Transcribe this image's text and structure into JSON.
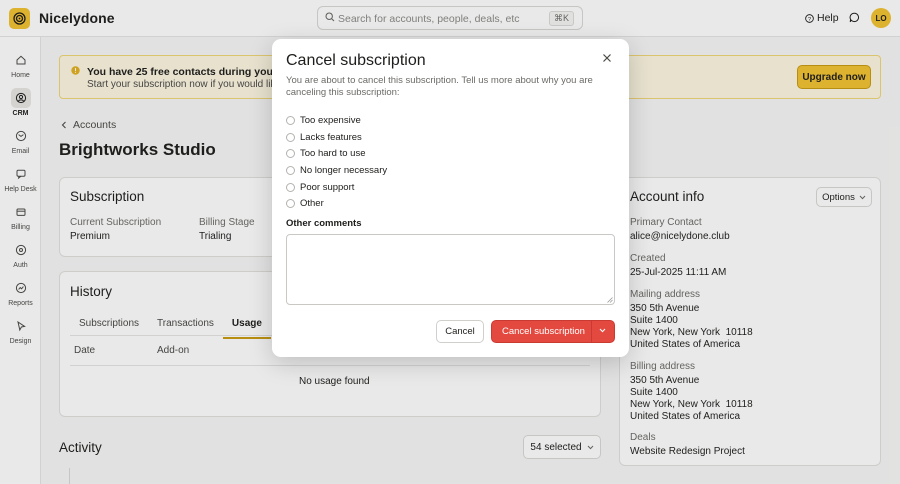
{
  "app": {
    "name": "Nicelydone"
  },
  "search": {
    "placeholder": "Search for accounts, people, deals, etc",
    "shortcut": "⌘K"
  },
  "header": {
    "help_label": "Help",
    "avatar_initials": "LO"
  },
  "sidebar": {
    "items": [
      {
        "label": "Home",
        "icon": "home-icon"
      },
      {
        "label": "CRM",
        "icon": "crm-icon",
        "active": true
      },
      {
        "label": "Email",
        "icon": "email-icon"
      },
      {
        "label": "Help Desk",
        "icon": "help-desk-icon"
      },
      {
        "label": "Billing",
        "icon": "billing-icon"
      },
      {
        "label": "Auth",
        "icon": "auth-icon"
      },
      {
        "label": "Reports",
        "icon": "reports-icon"
      },
      {
        "label": "Design",
        "icon": "design-icon"
      }
    ]
  },
  "banner": {
    "title": "You have 25 free contacts during your free trial",
    "subtitle": "Start your subscription now if you would like to i",
    "upgrade_label": "Upgrade now"
  },
  "breadcrumb": {
    "label": "Accounts"
  },
  "page": {
    "title": "Brightworks Studio"
  },
  "subscription": {
    "title": "Subscription",
    "current_label": "Current Subscription",
    "current_value": "Premium",
    "stage_label": "Billing Stage",
    "stage_value": "Trialing"
  },
  "history": {
    "title": "History",
    "tabs": [
      "Subscriptions",
      "Transactions",
      "Usage"
    ],
    "active_tab": "Usage",
    "columns": [
      "Date",
      "Add-on"
    ],
    "empty": "No usage found"
  },
  "account_info": {
    "title": "Account info",
    "options_label": "Options",
    "primary_contact_label": "Primary Contact",
    "primary_contact": "alice@nicelydone.club",
    "created_label": "Created",
    "created": "25-Jul-2025 11:11 AM",
    "mailing_label": "Mailing address",
    "mailing": [
      "350 5th Avenue",
      "Suite 1400",
      "New York, New York  10118",
      "United States of America"
    ],
    "billing_label": "Billing address",
    "billing": [
      "350 5th Avenue",
      "Suite 1400",
      "New York, New York  10118",
      "United States of America"
    ],
    "deals_label": "Deals",
    "deals": "Website Redesign Project"
  },
  "activity": {
    "title": "Activity",
    "selected_label": "54 selected"
  },
  "modal": {
    "title": "Cancel subscription",
    "description": "You are about to cancel this subscription. Tell us more about why you are canceling this subscription:",
    "reasons": [
      "Too expensive",
      "Lacks features",
      "Too hard to use",
      "No longer necessary",
      "Poor support",
      "Other"
    ],
    "comments_label": "Other comments",
    "comments_value": "",
    "cancel_label": "Cancel",
    "confirm_label": "Cancel subscription"
  },
  "colors": {
    "brand_yellow": "#f2c230",
    "danger": "#e4493f",
    "accent_underline": "#c99a0e"
  }
}
